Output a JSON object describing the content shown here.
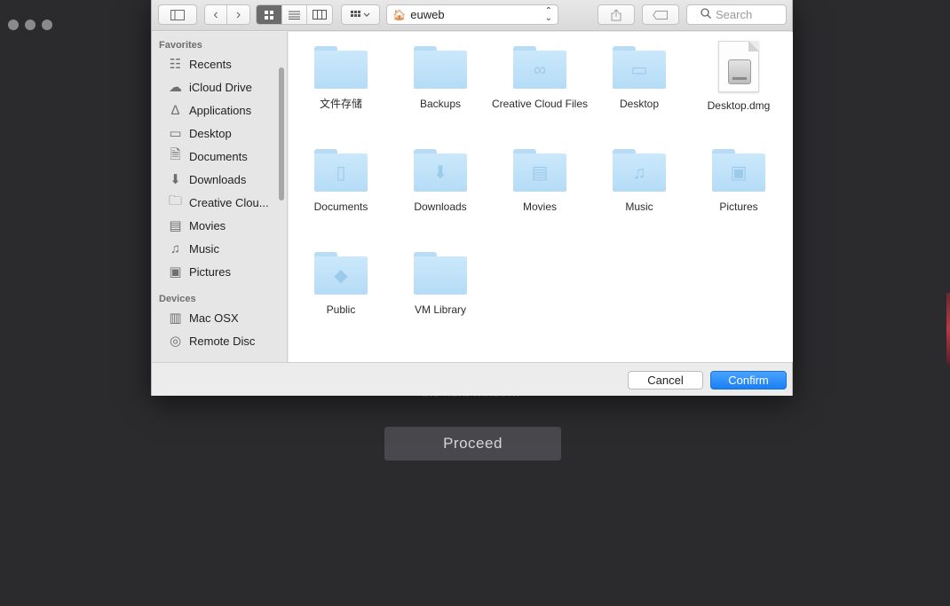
{
  "background": {
    "hint_text": "the next window.",
    "proceed_label": "Proceed"
  },
  "toolbar": {
    "path": "euweb",
    "search_placeholder": "Search"
  },
  "sidebar": {
    "favorites_title": "Favorites",
    "favorites": [
      {
        "label": "Recents",
        "icon": "recents-icon"
      },
      {
        "label": "iCloud Drive",
        "icon": "cloud-icon"
      },
      {
        "label": "Applications",
        "icon": "applications-icon"
      },
      {
        "label": "Desktop",
        "icon": "desktop-icon"
      },
      {
        "label": "Documents",
        "icon": "documents-icon"
      },
      {
        "label": "Downloads",
        "icon": "downloads-icon"
      },
      {
        "label": "Creative Clou...",
        "icon": "folder-icon"
      },
      {
        "label": "Movies",
        "icon": "movies-icon"
      },
      {
        "label": "Music",
        "icon": "music-icon"
      },
      {
        "label": "Pictures",
        "icon": "camera-icon"
      }
    ],
    "devices_title": "Devices",
    "devices": [
      {
        "label": "Mac OSX",
        "icon": "hard-drive-icon"
      },
      {
        "label": "Remote Disc",
        "icon": "disc-icon"
      }
    ]
  },
  "files": [
    {
      "name": "文件存储",
      "kind": "folder"
    },
    {
      "name": "Backups",
      "kind": "folder"
    },
    {
      "name": "Creative Cloud Files",
      "kind": "folder"
    },
    {
      "name": "Desktop",
      "kind": "folder"
    },
    {
      "name": "Desktop.dmg",
      "kind": "dmg"
    },
    {
      "name": "Documents",
      "kind": "folder"
    },
    {
      "name": "Downloads",
      "kind": "folder"
    },
    {
      "name": "Movies",
      "kind": "folder"
    },
    {
      "name": "Music",
      "kind": "folder"
    },
    {
      "name": "Pictures",
      "kind": "folder"
    },
    {
      "name": "Public",
      "kind": "folder"
    },
    {
      "name": "VM Library",
      "kind": "folder"
    }
  ],
  "buttons": {
    "cancel": "Cancel",
    "confirm": "Confirm"
  },
  "colors": {
    "accent": "#1a80f5",
    "folder": "#b5dcf6",
    "background": "#2b2b2e"
  }
}
